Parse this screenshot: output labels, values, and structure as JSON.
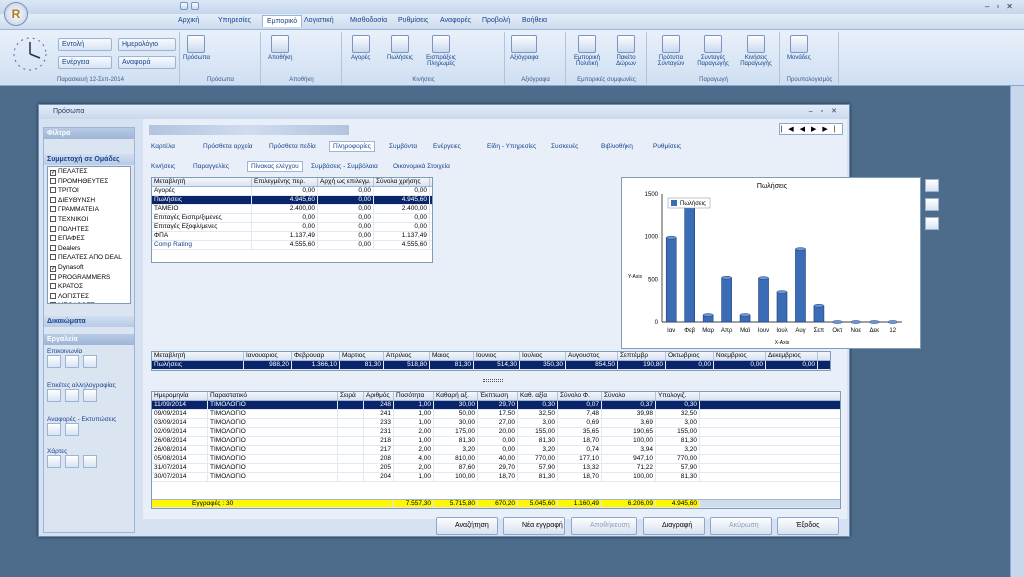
{
  "ribbon_tabs": [
    "Αρχική",
    "Υπηρεσίες",
    "Εμπορικό",
    "Λογιστική",
    "Μισθοδοσία",
    "Ρυθμίσεις",
    "Αναφορές",
    "Προβολή",
    "Βοήθεια"
  ],
  "active_tab": "Εμπορικό",
  "ribbon": {
    "date_caption": "Παρασκευή 12-Σεπ-2014",
    "entoli": "Εντολή",
    "imerologio": "Ημερολόγιο",
    "energeia": "Ενέργεια",
    "anafora": "Αναφορά",
    "prosopa": "Πρόσωπα",
    "prosopa_group": "Πρόσωπα",
    "apothiki": "Αποθήκη",
    "apothiki_group": "Αποθήκη",
    "agores": "Αγορές",
    "poliseis": "Πωλήσεις",
    "eisprakseis": "Εισπράξεις Πληρωμές",
    "kiniseis_group": "Κινήσεις",
    "axiografa": "Αξιόγραφα",
    "axiografa_group": "Αξιόγραφα",
    "emporiki_politiki": "Εμπορική Πολιτική",
    "paketo_doron": "Πακέτο Δώρων",
    "emporikes_group": "Εμπορικές συμφωνίες",
    "protypa_syntagon": "Πρότυπα Συνταγών",
    "syntages": "Συνταγές Παραγωγής",
    "kiniseis_paragogis": "Κινήσεις Παραγωγής",
    "paragogi_group": "Παραγωγή",
    "monades": "Μονάδες",
    "proupologismos_group": "Προυπολογισμός"
  },
  "window": {
    "title": "Πρόσωπα"
  },
  "sidebar": {
    "filters": "Φίλτρα",
    "groups_title": "Συμμετοχή σε Ομάδες",
    "groups": [
      {
        "label": "ΠΕΛΑΤΕΣ",
        "checked": true
      },
      {
        "label": "ΠΡΟΜΗΘΕΥΤΕΣ",
        "checked": false
      },
      {
        "label": "ΤΡΙΤΟΙ",
        "checked": false
      },
      {
        "label": "ΔΙΕΥΘΥΝΣΗ",
        "checked": false
      },
      {
        "label": "ΓΡΑΜΜΑΤΕΙΑ",
        "checked": false
      },
      {
        "label": "ΤΕΧΝΙΚΟΙ",
        "checked": false
      },
      {
        "label": "ΠΩΛΗΤΕΣ",
        "checked": false
      },
      {
        "label": "ΕΠΑΦΕΣ",
        "checked": false
      },
      {
        "label": "Dealers",
        "checked": false
      },
      {
        "label": "ΠΕΛΑΤΕΣ ΑΠΟ DEAL",
        "checked": false
      },
      {
        "label": "Dynasoft",
        "checked": true
      },
      {
        "label": "PROGRAMMERS",
        "checked": false
      },
      {
        "label": "ΚΡΑΤΟΣ",
        "checked": false
      },
      {
        "label": "ΛΟΓΙΣΤΕΣ",
        "checked": false
      },
      {
        "label": "MEGASOFT",
        "checked": false
      }
    ],
    "rights": "Δικαιώματα",
    "tools": "Εργαλεία",
    "communication": "Επικοινωνία",
    "labels": "Ετικέτες αλληλογραφίας",
    "reports": "Αναφορές - Εκτυπώσεις",
    "maps": "Χάρτες"
  },
  "person_tabs": [
    "Καρτέλα",
    "Πρόσθετα αρχεία",
    "Πρόσθετα πεδία",
    "Πληροφορίες",
    "Συμβόντα",
    "Ενέργειες",
    "Είδη - Υπηρεσίες",
    "Συσκευές",
    "Βιβλιοθήκη",
    "Ρυθμίσεις"
  ],
  "active_person_tab": "Πληροφορίες",
  "sub_tabs": [
    "Κινήσεις",
    "Παραγγελίες",
    "Πίνακας ελέγχου",
    "Συμβάσεις - Συμβόλαια",
    "Οικονομικά Στοιχεία"
  ],
  "active_sub_tab": "Πίνακας ελέγχου",
  "control": {
    "headers": [
      "Μεταβλητή",
      "Επιλεγμένης περ.",
      "Αρχή ως επιλεγμ.",
      "Σύνολα χρήσης"
    ],
    "rows": [
      [
        "Αγορές",
        "0,00",
        "0,00",
        "0,00"
      ],
      [
        "Πωλήσεις",
        "4.945,60",
        "0,00",
        "4.945,60"
      ],
      [
        "ΤΑΜΕΙΟ",
        "2.400,00",
        "0,00",
        "2.400,00"
      ],
      [
        "Επιταγές Εισπρ/ξιμενες",
        "0,00",
        "0,00",
        "0,00"
      ],
      [
        "Επιταγές Εξοφλ/μενες",
        "0,00",
        "0,00",
        "0,00"
      ],
      [
        "ΦΠΑ",
        "1.137,49",
        "0,00",
        "1.137,49"
      ],
      [
        "Comp Rating",
        "4.555,60",
        "0,00",
        "4.555,60"
      ]
    ]
  },
  "chart_data": {
    "type": "bar",
    "title": "Πωλήσεις",
    "ylabel": "Y-Axis",
    "xlabel": "X-Axis",
    "categories": [
      "Ιαν",
      "Φεβ",
      "Μαρ",
      "Απρ",
      "Μαϊ",
      "Ιουν",
      "Ιουλ",
      "Αυγ",
      "Σεπ",
      "Οκτ",
      "Νοε",
      "Δεκ",
      "12"
    ],
    "series": [
      {
        "name": "Πωλήσεις",
        "values": [
          988.2,
          1366.1,
          81.3,
          518.8,
          81.3,
          514.3,
          350.3,
          854.5,
          190.8,
          0,
          0,
          0,
          0
        ]
      }
    ],
    "ylim": [
      0,
      1500
    ],
    "yticks": [
      0,
      500,
      1000,
      1500
    ],
    "legend": "top-left",
    "color": "#3a6db5"
  },
  "monthly": {
    "headers": [
      "Μεταβλητή",
      "Ιανουαριος",
      "Φεβρουαρ",
      "Μαρτιος",
      "Απριλιος",
      "Μαιος",
      "Ιουνιος",
      "Ιουλιος",
      "Αυγουστος",
      "Σεπτέμβρ",
      "Οκτωβριος",
      "Νοεμβριος",
      "Δεκεμβριος"
    ],
    "row": [
      "Πωλήσεις",
      "988,20",
      "1.366,10",
      "81,30",
      "518,80",
      "81,30",
      "514,30",
      "350,30",
      "854,50",
      "190,80",
      "0,00",
      "0,00",
      "0,00"
    ]
  },
  "docs": {
    "headers": [
      "Ημερομηνία",
      "Παραστατικό",
      "Σειρά",
      "Αριθμός",
      "Ποσότητα",
      "Καθαρή αξ.",
      "Έκπτωση",
      "Καθ. αξία",
      "Σύνολο Φ.",
      "Σύνολο",
      "Υπολογιζ."
    ],
    "rows": [
      [
        "11/09/2014",
        "ΤΙΜΟΛΟΓΙΟ",
        "",
        "248",
        "1,00",
        "30,00",
        "29,70",
        "0,30",
        "0,07",
        "0,37",
        "0,30"
      ],
      [
        "09/09/2014",
        "ΤΙΜΟΛΟΓΙΟ",
        "",
        "241",
        "1,00",
        "50,00",
        "17,50",
        "32,50",
        "7,48",
        "39,98",
        "32,50"
      ],
      [
        "03/09/2014",
        "ΤΙΜΟΛΟΓΙΟ",
        "",
        "233",
        "1,00",
        "30,00",
        "27,00",
        "3,00",
        "0,69",
        "3,69",
        "3,00"
      ],
      [
        "02/09/2014",
        "ΤΙΜΟΛΟΓΙΟ",
        "",
        "231",
        "2,00",
        "175,00",
        "20,00",
        "155,00",
        "35,65",
        "190,65",
        "155,00"
      ],
      [
        "26/08/2014",
        "ΤΙΜΟΛΟΓΙΟ",
        "",
        "218",
        "1,00",
        "81,30",
        "0,00",
        "81,30",
        "18,70",
        "100,00",
        "81,30"
      ],
      [
        "26/08/2014",
        "ΤΙΜΟΛΟΓΙΟ",
        "",
        "217",
        "2,00",
        "3,20",
        "0,00",
        "3,20",
        "0,74",
        "3,94",
        "3,20"
      ],
      [
        "05/08/2014",
        "ΤΙΜΟΛΟΓΙΟ",
        "",
        "208",
        "4,00",
        "810,00",
        "40,00",
        "770,00",
        "177,10",
        "947,10",
        "770,00"
      ],
      [
        "31/07/2014",
        "ΤΙΜΟΛΟΓΙΟ",
        "",
        "205",
        "2,00",
        "87,60",
        "29,70",
        "57,90",
        "13,32",
        "71,22",
        "57,90"
      ],
      [
        "30/07/2014",
        "ΤΙΜΟΛΟΓΙΟ",
        "",
        "204",
        "1,00",
        "100,00",
        "18,70",
        "81,30",
        "18,70",
        "100,00",
        "81,30"
      ]
    ],
    "footer_label": "Εγγραφές : 30",
    "totals": [
      "7.557,30",
      "5.715,80",
      "670,20",
      "5.045,60",
      "1.160,49",
      "6.206,09",
      "4.945,60"
    ]
  },
  "buttons": {
    "search": "Αναζήτηση",
    "new": "Νέα εγγραφή",
    "save": "Αποθήκευση",
    "delete": "Διαγραφή",
    "cancel": "Ακύρωση",
    "exit": "Έξοδος"
  }
}
